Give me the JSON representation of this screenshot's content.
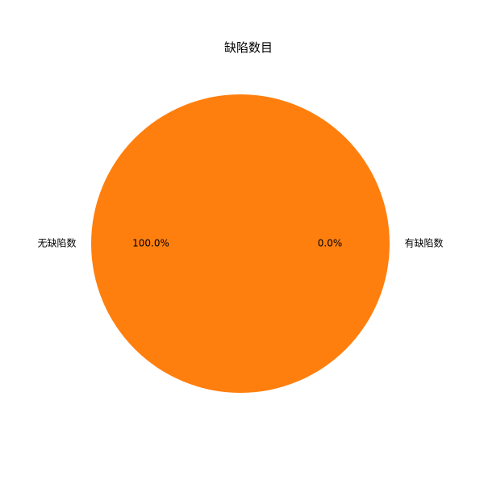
{
  "chart_data": {
    "type": "pie",
    "title": "缺陷数目",
    "slices": [
      {
        "label": "有缺陷数",
        "value": 0,
        "pct_label": "0.0%",
        "color": "#1f77b4"
      },
      {
        "label": "无缺陷数",
        "value": 100,
        "pct_label": "100.0%",
        "color": "#ff7f0e"
      }
    ]
  }
}
